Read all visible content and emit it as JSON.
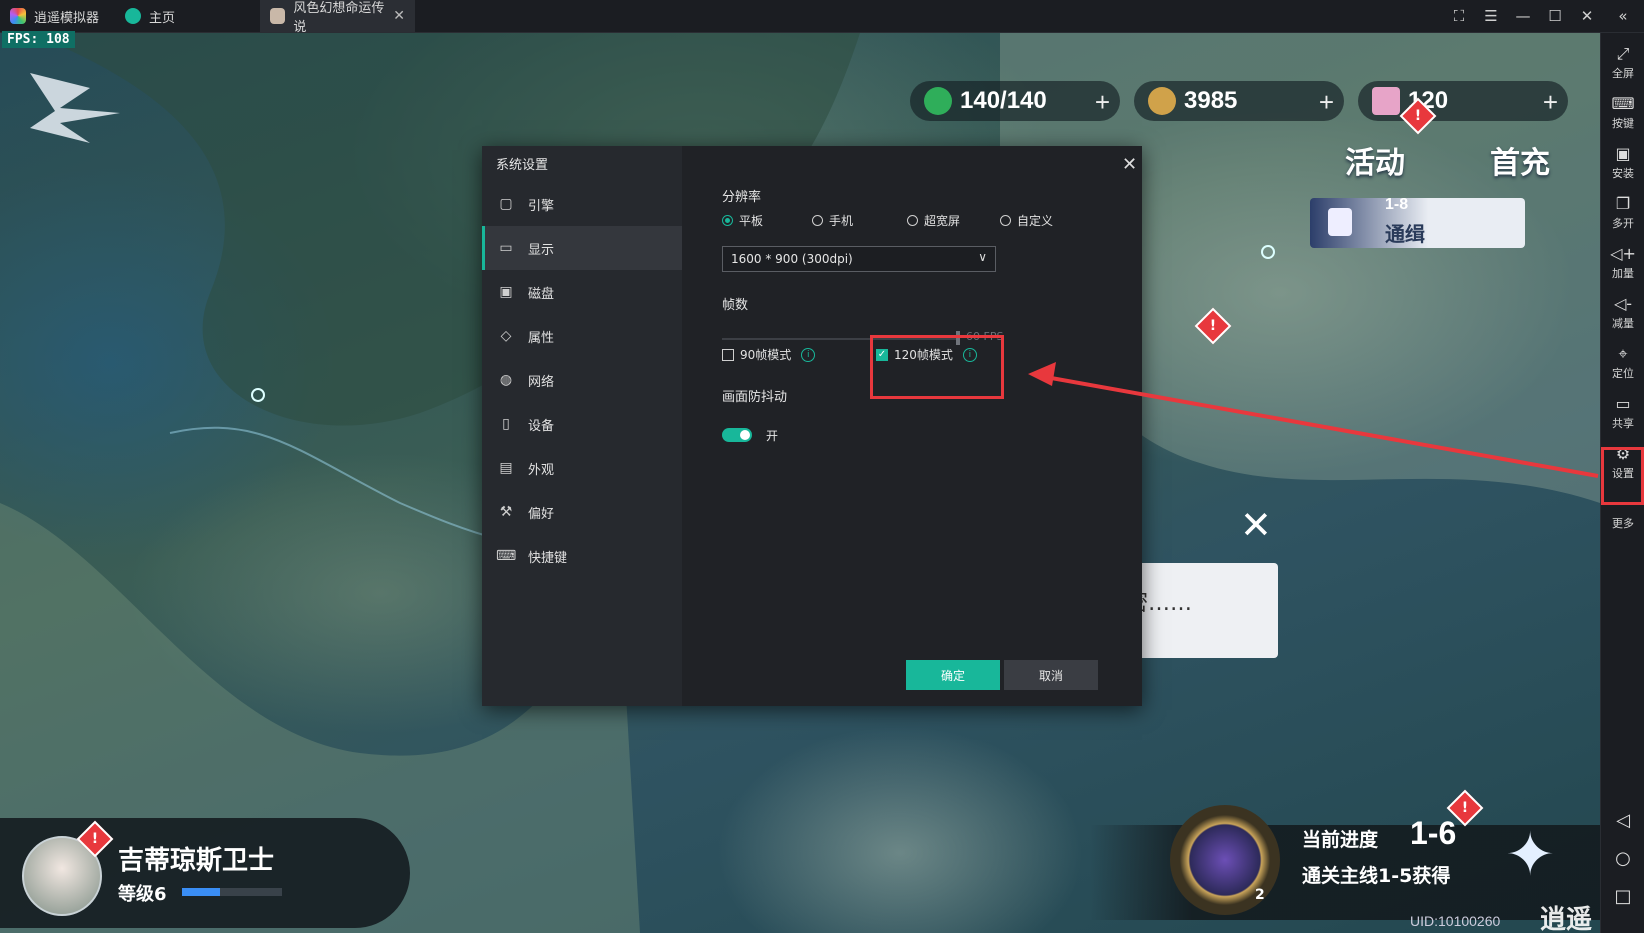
{
  "titlebar": {
    "app_name": "逍遥模拟器",
    "home_tab": "主页",
    "game_tab": "风色幻想命运传说",
    "tab_close": "✕",
    "controls": [
      "⛶",
      "☰",
      "—",
      "☐",
      "✕",
      "«"
    ]
  },
  "game": {
    "fps": "FPS: 108",
    "stamina": "140/140",
    "coins": "3985",
    "gems": "120",
    "plus": "+",
    "activity": "活动",
    "first_charge": "首充",
    "stage_label": "1-8",
    "stage_lock": "通缉",
    "dialog_text": "密……",
    "player_name": "吉蒂琼斯卫士",
    "player_level": "等级6",
    "progress_label": "当前进度",
    "progress_value": "1-6",
    "progress_desc": "通关主线1-5获得",
    "reward_count": "2",
    "uid": "UID:10100260",
    "watermark": "逍遥安"
  },
  "sidebar": {
    "items": [
      {
        "icon": "fullscreen-icon",
        "glyph": "⤢",
        "label": "全屏"
      },
      {
        "icon": "keyboard-icon",
        "glyph": "⌨",
        "label": "按键"
      },
      {
        "icon": "apk-icon",
        "glyph": "▣",
        "label": "安装"
      },
      {
        "icon": "multi-instance-icon",
        "glyph": "❐",
        "label": "多开"
      },
      {
        "icon": "volume-up-icon",
        "glyph": "◁+",
        "label": "加量"
      },
      {
        "icon": "volume-down-icon",
        "glyph": "◁-",
        "label": "减量"
      },
      {
        "icon": "location-icon",
        "glyph": "⌖",
        "label": "定位"
      },
      {
        "icon": "folder-icon",
        "glyph": "▭",
        "label": "共享"
      },
      {
        "icon": "gear-icon",
        "glyph": "⚙",
        "label": "设置"
      },
      {
        "icon": "more-icon",
        "glyph": "⋯",
        "label": "更多"
      }
    ],
    "nav": [
      "◁",
      "○",
      "□"
    ]
  },
  "settings": {
    "title": "系统设置",
    "close": "✕",
    "nav": [
      {
        "icon": "engine-icon",
        "glyph": "▢",
        "label": "引擎"
      },
      {
        "icon": "display-icon",
        "glyph": "▭",
        "label": "显示"
      },
      {
        "icon": "disk-icon",
        "glyph": "▣",
        "label": "磁盘"
      },
      {
        "icon": "tag-icon",
        "glyph": "◇",
        "label": "属性"
      },
      {
        "icon": "globe-icon",
        "glyph": "◍",
        "label": "网络"
      },
      {
        "icon": "phone-icon",
        "glyph": "▯",
        "label": "设备"
      },
      {
        "icon": "appearance-icon",
        "glyph": "▤",
        "label": "外观"
      },
      {
        "icon": "wrench-icon",
        "glyph": "⚒",
        "label": "偏好"
      },
      {
        "icon": "shortcut-icon",
        "glyph": "⌨",
        "label": "快捷键"
      }
    ],
    "active_nav": "显示",
    "resolution": {
      "label": "分辨率",
      "options": [
        "平板",
        "手机",
        "超宽屏",
        "自定义"
      ],
      "selected": "平板",
      "value": "1600 * 900 (300dpi)"
    },
    "fps": {
      "label": "帧数",
      "slider_value": "60 FPS",
      "mode90": {
        "label": "90帧模式",
        "checked": false
      },
      "mode120": {
        "label": "120帧模式",
        "checked": true
      }
    },
    "anti_shake": {
      "label": "画面防抖动",
      "state": "开",
      "on": true
    },
    "ok": "确定",
    "cancel": "取消"
  },
  "colors": {
    "accent": "#18b79a",
    "highlight": "#e8383d"
  }
}
